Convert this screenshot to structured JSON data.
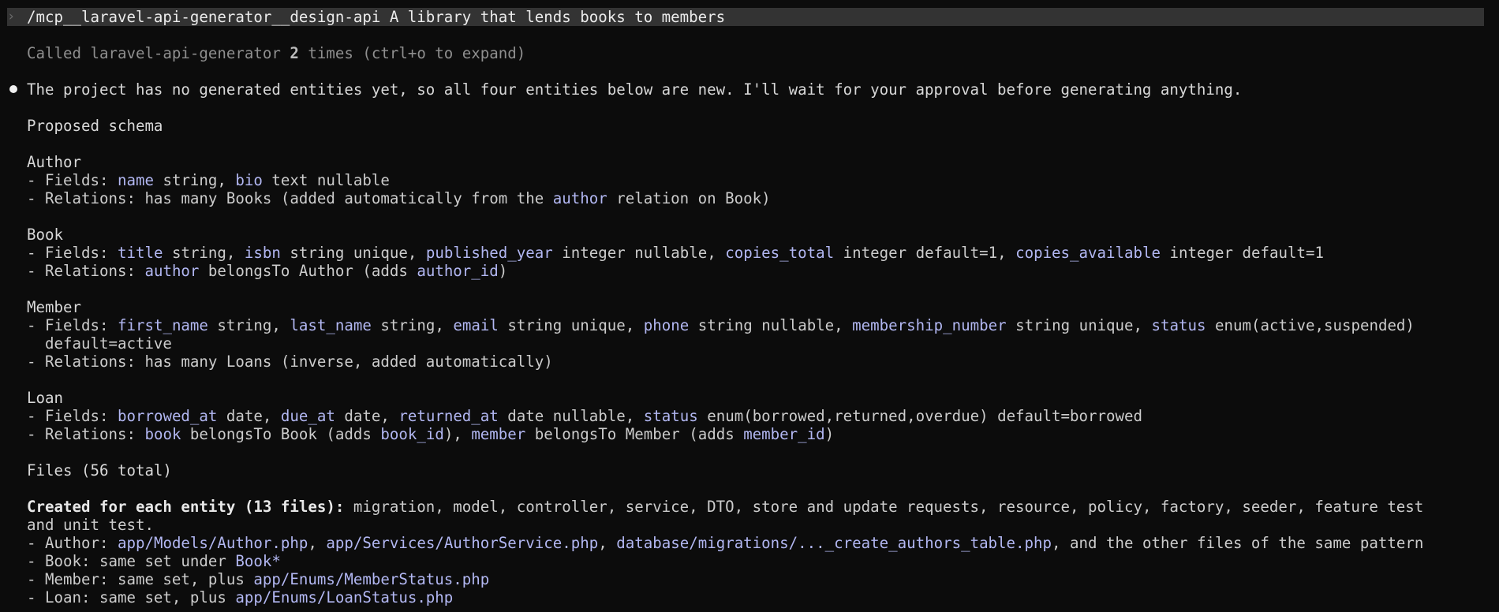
{
  "colors": {
    "background": "#0c0c0c",
    "text": "#cccccc",
    "identifier": "#b2b7f2",
    "prompt_bar": "#333333"
  },
  "prompt": {
    "icon": "chevron-right-icon",
    "command": "/mcp__laravel-api-generator__design-api A library that lends books to members"
  },
  "tool_call": {
    "prefix": "Called laravel-api-generator ",
    "count": "2",
    "suffix": " times (ctrl+o to expand)"
  },
  "intro": "The project has no generated entities yet, so all four entities below are new. I'll wait for your approval before generating anything.",
  "schema_heading": "Proposed schema",
  "entities": {
    "author": {
      "title": "Author",
      "fields": [
        "- Fields: ",
        "name",
        " string, ",
        "bio",
        " text nullable"
      ],
      "relations": [
        "- Relations: has many Books (added automatically from the ",
        "author",
        " relation on Book)"
      ]
    },
    "book": {
      "title": "Book",
      "fields": [
        "- Fields: ",
        "title",
        " string, ",
        "isbn",
        " string unique, ",
        "published_year",
        " integer nullable, ",
        "copies_total",
        " integer default=1, ",
        "copies_available",
        " integer default=1"
      ],
      "relations": [
        "- Relations: ",
        "author",
        " belongsTo Author (adds ",
        "author_id",
        ")"
      ]
    },
    "member": {
      "title": "Member",
      "fields": [
        "- Fields: ",
        "first_name",
        " string, ",
        "last_name",
        " string, ",
        "email",
        " string unique, ",
        "phone",
        " string nullable, ",
        "membership_number",
        " string unique, ",
        "status",
        " enum(active,suspended)"
      ],
      "fields_cont": "  default=active",
      "relations": [
        "- Relations: has many Loans (inverse, added automatically)"
      ]
    },
    "loan": {
      "title": "Loan",
      "fields": [
        "- Fields: ",
        "borrowed_at",
        " date, ",
        "due_at",
        " date, ",
        "returned_at",
        " date nullable, ",
        "status",
        " enum(borrowed,returned,overdue) default=borrowed"
      ],
      "relations": [
        "- Relations: ",
        "book",
        " belongsTo Book (adds ",
        "book_id",
        "), ",
        "member",
        " belongsTo Member (adds ",
        "member_id",
        ")"
      ]
    }
  },
  "files_heading": "Files (56 total)",
  "files": {
    "created_label": "Created for each entity (13 files):",
    "created_text": " migration, model, controller, service, DTO, store and update requests, resource, policy, factory, seeder, feature test",
    "created_cont": "and unit test.",
    "author": [
      "- Author: ",
      "app/Models/Author.php",
      ", ",
      "app/Services/AuthorService.php",
      ", ",
      "database/migrations/..._create_authors_table.php",
      ", and the other files of the same pattern"
    ],
    "book": [
      "- Book: same set under ",
      "Book*"
    ],
    "member": [
      "- Member: same set, plus ",
      "app/Enums/MemberStatus.php"
    ],
    "loan": [
      "- Loan: same set, plus ",
      "app/Enums/LoanStatus.php"
    ]
  }
}
